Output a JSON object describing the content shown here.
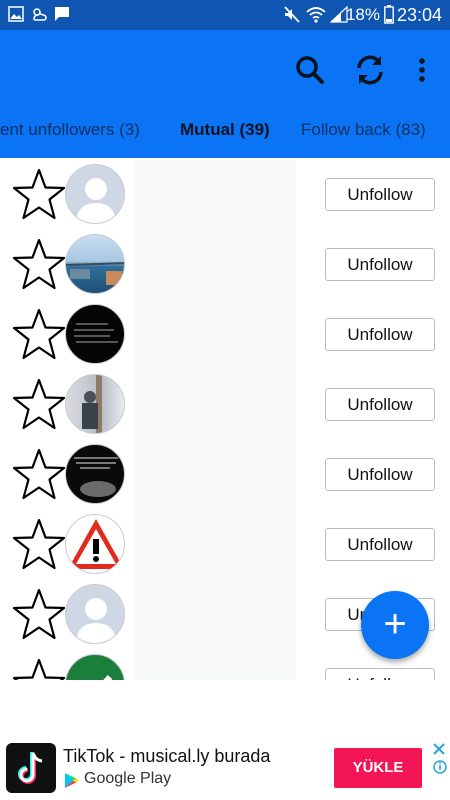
{
  "status_bar": {
    "battery_percent": "18%",
    "time": "23:04"
  },
  "app_bar": {
    "search_icon": "search-icon",
    "refresh_icon": "refresh-icon",
    "more_icon": "more-vert-icon"
  },
  "tabs": [
    {
      "label": "ent unfollowers (3)"
    },
    {
      "label": "Mutual (39)"
    },
    {
      "label": "Follow back (83)"
    }
  ],
  "rows": [
    {
      "button": "Unfollow"
    },
    {
      "button": "Unfollow"
    },
    {
      "button": "Unfollow"
    },
    {
      "button": "Unfollow"
    },
    {
      "button": "Unfollow"
    },
    {
      "button": "Unfollow"
    },
    {
      "button": "Unfollow"
    },
    {
      "button": "Unfollow"
    }
  ],
  "fab": {
    "symbol": "+"
  },
  "ad": {
    "title": "TikTok - musical.ly burada",
    "store": "Google Play",
    "install": "YÜKLE"
  },
  "colors": {
    "status_bar": "#0f56b3",
    "app_bar": "#0a74f5",
    "install_button": "#f31556"
  }
}
